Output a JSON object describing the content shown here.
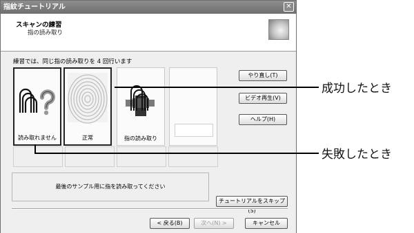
{
  "window": {
    "title": "指紋チュートリアル",
    "close_glyph": "✕"
  },
  "header": {
    "title": "スキャンの練習",
    "subtitle": "指の読み取り"
  },
  "instruction": "練習では、同じ指の読み取りを 4 回行います",
  "panels": [
    {
      "label": "読み取れません",
      "icon": "fingers-question-icon"
    },
    {
      "label": "正常",
      "icon": "fingerprint-icon"
    },
    {
      "label": "指の読み取り",
      "icon": "finger-on-sensor-icon"
    },
    {
      "label": "",
      "icon": ""
    }
  ],
  "buttons": {
    "redo": "やり直し(T)",
    "video": "ビデオ再生(V)",
    "help": "ヘルプ(H)",
    "skip": "チュートリアルをスキップ(S)",
    "back": "< 戻る(B)",
    "next": "次へ(N) >",
    "cancel": "キャンセル"
  },
  "message": "最後のサンプル用に指を読み取ってください",
  "callouts": {
    "success": "成功したとき",
    "failure": "失敗したとき"
  }
}
